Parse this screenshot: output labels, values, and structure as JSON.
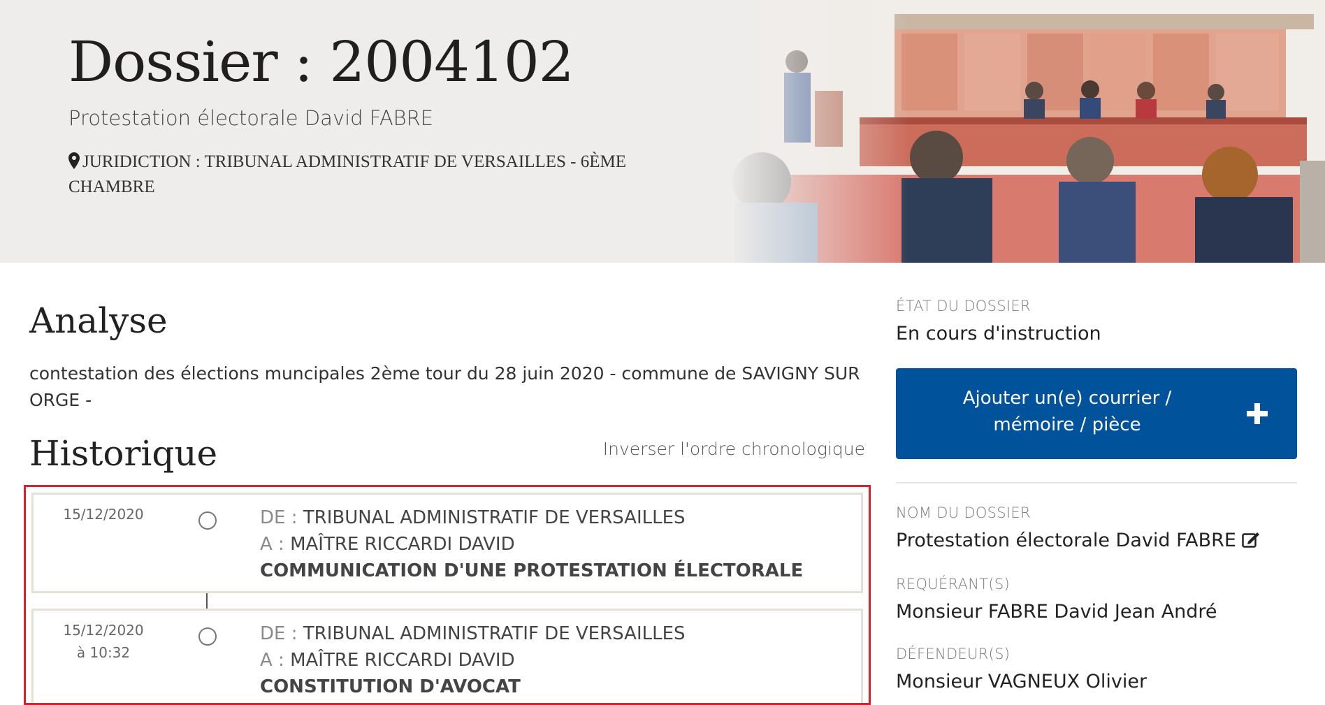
{
  "header": {
    "title": "Dossier : 2004102",
    "subtitle": "Protestation électorale David FABRE",
    "juridiction": "JURIDICTION : TRIBUNAL ADMINISTRATIF DE VERSAILLES - 6ÈME CHAMBRE",
    "pin_icon": "map-marker-icon"
  },
  "analyse": {
    "heading": "Analyse",
    "text": "contestation des élections muncipales 2ème tour du 28 juin 2020 - commune de SAVIGNY SUR ORGE -"
  },
  "historique": {
    "heading": "Historique",
    "invert_label": "Inverser l'ordre chronologique",
    "entries": [
      {
        "date": "15/12/2020",
        "time": "",
        "de_label": "DE :",
        "de_value": "TRIBUNAL ADMINISTRATIF DE VERSAILLES",
        "a_label": "A :",
        "a_value": "MAÎTRE RICCARDI DAVID",
        "object": "COMMUNICATION D'UNE PROTESTATION ÉLECTORALE"
      },
      {
        "date": "15/12/2020",
        "time": "à 10:32",
        "de_label": "DE :",
        "de_value": "TRIBUNAL ADMINISTRATIF DE VERSAILLES",
        "a_label": "A :",
        "a_value": "MAÎTRE RICCARDI DAVID",
        "object": "CONSTITUTION D'AVOCAT"
      }
    ]
  },
  "sidebar": {
    "etat_label": "ÉTAT DU DOSSIER",
    "etat_value": "En cours d'instruction",
    "add_button_label": "Ajouter un(e) courrier / mémoire / pièce",
    "add_button_icon": "plus-icon",
    "nom_label": "NOM DU DOSSIER",
    "nom_value": "Protestation électorale David FABRE",
    "requerants_label": "REQUÉRANT(S)",
    "requerants_value": "Monsieur FABRE David Jean André",
    "defendeurs_label": "DÉFENDEUR(S)",
    "defendeurs_value": "Monsieur VAGNEUX Olivier"
  },
  "colors": {
    "primary_button": "#00529b",
    "highlight_frame": "#d8202e",
    "hero_background": "#efedeb"
  }
}
